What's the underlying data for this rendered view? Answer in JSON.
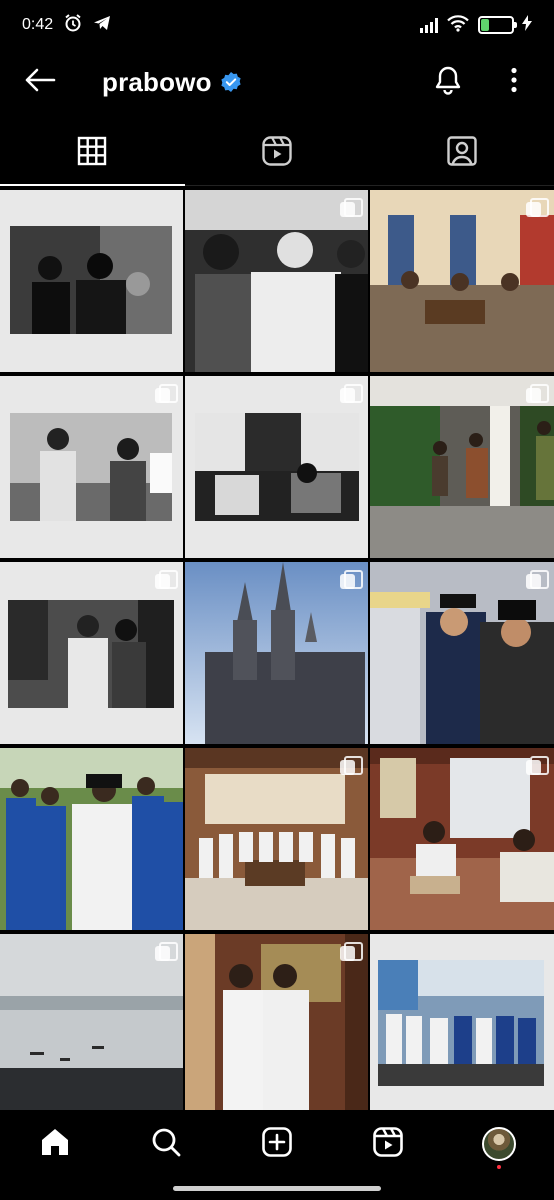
{
  "status_bar": {
    "time": "0:42",
    "battery_level": "30",
    "icons": [
      "alarm-icon",
      "telegram-icon",
      "signal-icon",
      "wifi-icon",
      "battery-icon",
      "charging-icon"
    ]
  },
  "header": {
    "username": "prabowo",
    "verified": true,
    "icons": [
      "back-arrow-icon",
      "verified-badge-icon",
      "bell-icon",
      "more-vertical-icon"
    ]
  },
  "tabs": [
    {
      "name": "grid",
      "icon": "grid-icon",
      "active": true
    },
    {
      "name": "reels",
      "icon": "reels-icon",
      "active": false
    },
    {
      "name": "tagged",
      "icon": "tagged-person-icon",
      "active": false
    }
  ],
  "posts": [
    {
      "scene": "bw-frame",
      "multi": false
    },
    {
      "scene": "bw-crowd",
      "multi": true
    },
    {
      "scene": "color-room",
      "multi": true
    },
    {
      "scene": "bw-frame",
      "multi": true
    },
    {
      "scene": "bw-frame",
      "multi": true
    },
    {
      "scene": "color-garden",
      "multi": true
    },
    {
      "scene": "bw-frame",
      "multi": true
    },
    {
      "scene": "color-cathedral",
      "multi": true
    },
    {
      "scene": "color-salute",
      "multi": true
    },
    {
      "scene": "color-group",
      "multi": false
    },
    {
      "scene": "color-office",
      "multi": true
    },
    {
      "scene": "color-meeting",
      "multi": true
    },
    {
      "scene": "color-sea",
      "multi": true
    },
    {
      "scene": "color-portrait",
      "multi": true
    },
    {
      "scene": "color-white-frame",
      "multi": false
    }
  ],
  "bottom_nav": [
    {
      "name": "home",
      "icon": "home-icon",
      "active": true
    },
    {
      "name": "search",
      "icon": "search-icon",
      "active": false
    },
    {
      "name": "create",
      "icon": "add-post-icon",
      "active": false
    },
    {
      "name": "reels",
      "icon": "reels-icon",
      "active": false
    },
    {
      "name": "profile",
      "icon": "profile-avatar-icon",
      "active": false
    }
  ],
  "colors": {
    "background": "#000000",
    "verified_blue": "#3897f0",
    "battery_green": "#5fd36d",
    "notification_red": "#ff3040"
  }
}
